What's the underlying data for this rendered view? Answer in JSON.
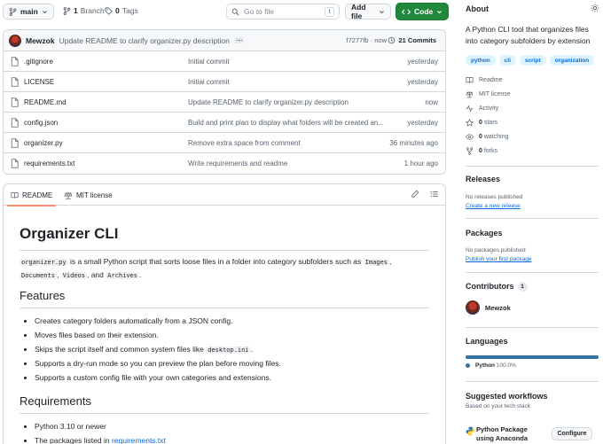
{
  "topbar": {
    "branch": "main",
    "branches_count": "1",
    "branches_label": "Branch",
    "tags_count": "0",
    "tags_label": "Tags",
    "search_placeholder": "Go to file",
    "search_shortcut": "t",
    "add_file": "Add file",
    "code": "Code"
  },
  "commit": {
    "author": "Mewzok",
    "message": "Update README to clarify organizer.py description",
    "hash_time": "f7277fb · now",
    "commits_count": "21 Commits"
  },
  "files": [
    {
      "name": ".gitignore",
      "message": "Initial commit",
      "time": "yesterday"
    },
    {
      "name": "LICENSE",
      "message": "Initial commit",
      "time": "yesterday"
    },
    {
      "name": "README.md",
      "message": "Update README to clarify organizer.py description",
      "time": "now"
    },
    {
      "name": "config.json",
      "message": "Build and print plan to display what folders will be created an...",
      "time": "yesterday"
    },
    {
      "name": "organizer.py",
      "message": "Remove extra space from comment",
      "time": "36 minutes ago"
    },
    {
      "name": "requirements.txt",
      "message": "Write requirements and readme",
      "time": "1 hour ago"
    }
  ],
  "readme_tabs": {
    "readme": "README",
    "license": "MIT license"
  },
  "readme": {
    "title": "Organizer CLI",
    "intro_code": "organizer.py",
    "intro_text": " is a small Python script that sorts loose files in a folder into category subfolders such as ",
    "code_images": "Images",
    "sep1": ",",
    "code_documents": "Documents",
    "sep2": ",",
    "code_videos": "Videos",
    "sep3": ", and",
    "code_archives": "Archives",
    "end": ".",
    "features_heading": "Features",
    "features": [
      "Creates category folders automatically from a JSON config.",
      "Moves files based on their extension.",
      "Skips the script itself and common system files like ",
      "Supports a dry-run mode so you can preview the plan before moving files.",
      "Supports a custom config file with your own categories and extensions."
    ],
    "feature3_code": "desktop.ini",
    "feature3_end": ".",
    "requirements_heading": "Requirements",
    "requirements": [
      "Python 3.10 or newer",
      "The packages listed in "
    ],
    "requirements_link": "requirements.txt"
  },
  "about": {
    "heading": "About",
    "description": "A Python CLI tool that organizes files into category subfolders by extension",
    "topics": [
      "python",
      "cli",
      "script",
      "organization"
    ],
    "readme": "Readme",
    "license": "MIT license",
    "activity": "Activity",
    "stars": "0",
    "stars_label": "stars",
    "watching": "0",
    "watching_label": "watching",
    "forks": "0",
    "forks_label": "forks"
  },
  "releases": {
    "heading": "Releases",
    "empty": "No releases published",
    "link": "Create a new release"
  },
  "packages": {
    "heading": "Packages",
    "empty": "No packages published",
    "link": "Publish your first package"
  },
  "contributors": {
    "heading": "Contributors",
    "count": "1",
    "name": "Mewzok"
  },
  "languages": {
    "heading": "Languages",
    "name": "Python",
    "percent": "100.0%",
    "color": "#3572A5"
  },
  "workflows": {
    "heading": "Suggested workflows",
    "subtitle": "Based on your tech stack",
    "name": "Python Package using Anaconda",
    "button": "Configure"
  },
  "colors": {
    "code_button": "#1f883d",
    "link": "#0969da",
    "topic_bg": "#ddf4ff",
    "tab_underline": "#fd8c73"
  }
}
